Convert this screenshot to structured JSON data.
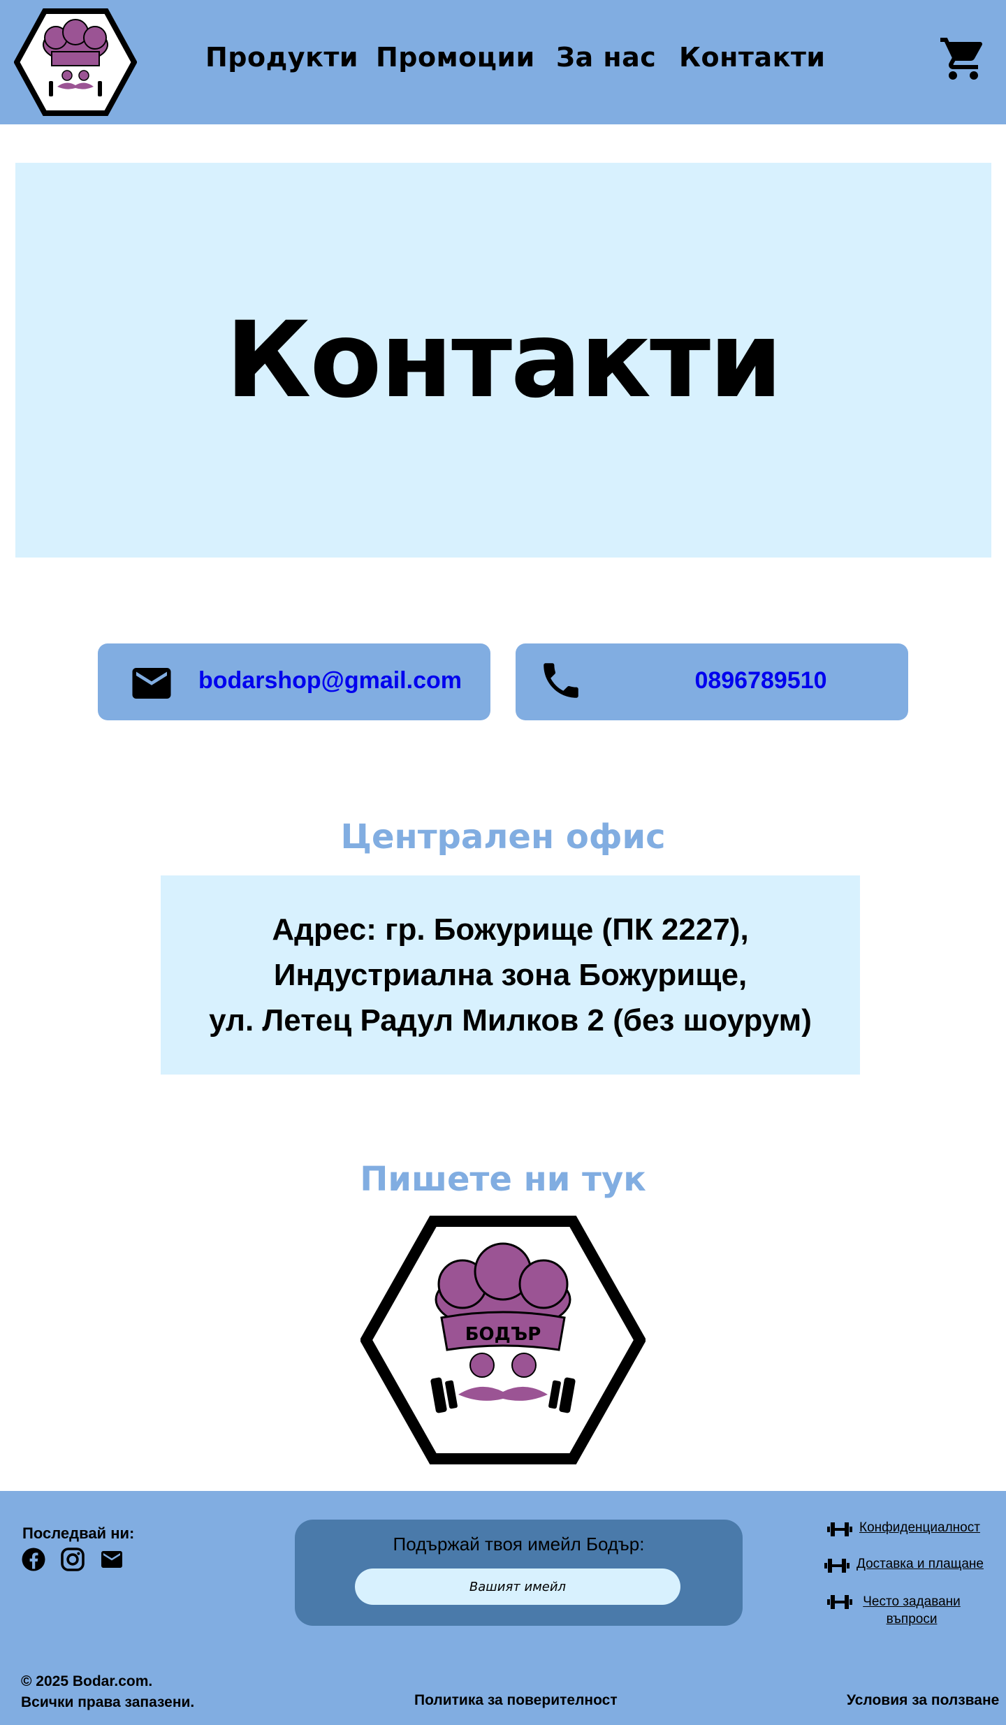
{
  "header": {
    "nav": [
      "Продукти",
      "Промоции",
      "За нас",
      "Контакти"
    ],
    "logo_icon": "chef-hat-mascot-logo",
    "cart_icon": "cart-icon"
  },
  "hero": {
    "title": "Контакти"
  },
  "contacts": {
    "email": "bodarshop@gmail.com",
    "phone": "0896789510",
    "email_icon": "mail-icon",
    "phone_icon": "phone-icon"
  },
  "office": {
    "title": "Централен офис",
    "address_lines": [
      "Адрес: гр. Божурище (ПК 2227),",
      "Индустриална зона Божурище,",
      "ул. Летец Радул Милков 2 (без шоурум)"
    ]
  },
  "write": {
    "title": "Пишете ни тук"
  },
  "footer": {
    "follow_label": "Последвай ни:",
    "social_icons": [
      "facebook-icon",
      "instagram-icon",
      "mail-icon"
    ],
    "newsletter": {
      "label": "Подържай твоя имейл Бодър:",
      "placeholder": "Вашият имейл"
    },
    "links": [
      "Конфиденциалност",
      "Доставка и плащане",
      "Често задавани въпроси"
    ],
    "copyright_line1": "© 2025 Bodar.com.",
    "copyright_line2": "Всички права запазени.",
    "privacy": "Политика за поверителност",
    "terms": "Условия за ползване"
  },
  "colors": {
    "header_bg": "#81ade1",
    "light_panel": "#d8f1fe",
    "newsletter_bg": "#4a7aaa",
    "logo_purple": "#9b5494"
  }
}
